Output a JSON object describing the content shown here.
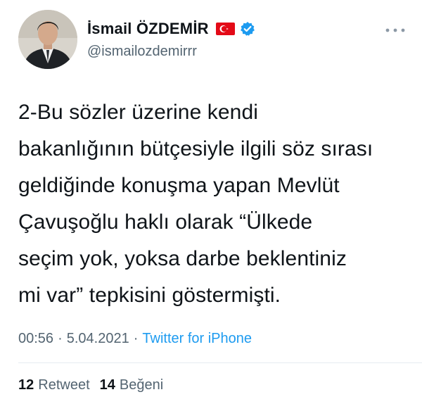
{
  "author": {
    "display_name": "İsmail ÖZDEMİR",
    "handle": "@ismailozdemirrr",
    "flag_icon": "turkish-flag-icon",
    "verified_icon": "verified-badge-icon",
    "avatar_icon": "profile-photo"
  },
  "menu_icon": "more-dots-icon",
  "tweet": {
    "lines": [
      "2-Bu sözler üzerine kendi",
      "bakanlığının bütçesiyle ilgili söz sırası",
      "geldiğinde konuşma yapan Mevlüt",
      "Çavuşoğlu haklı olarak “Ülkede",
      "seçim yok, yoksa darbe beklentiniz",
      "mi var” tepkisini göstermişti."
    ]
  },
  "meta": {
    "time": "00:56",
    "date": "5.04.2021",
    "separator": "·",
    "source": "Twitter for iPhone"
  },
  "stats": {
    "retweets_count": "12",
    "retweets_label": "Retweet",
    "likes_count": "14",
    "likes_label": "Beğeni"
  },
  "colors": {
    "text": "#0f1419",
    "secondary": "#536471",
    "link": "#1d9bf0",
    "verified": "#1d9bf0",
    "flag_red": "#e30a17"
  }
}
